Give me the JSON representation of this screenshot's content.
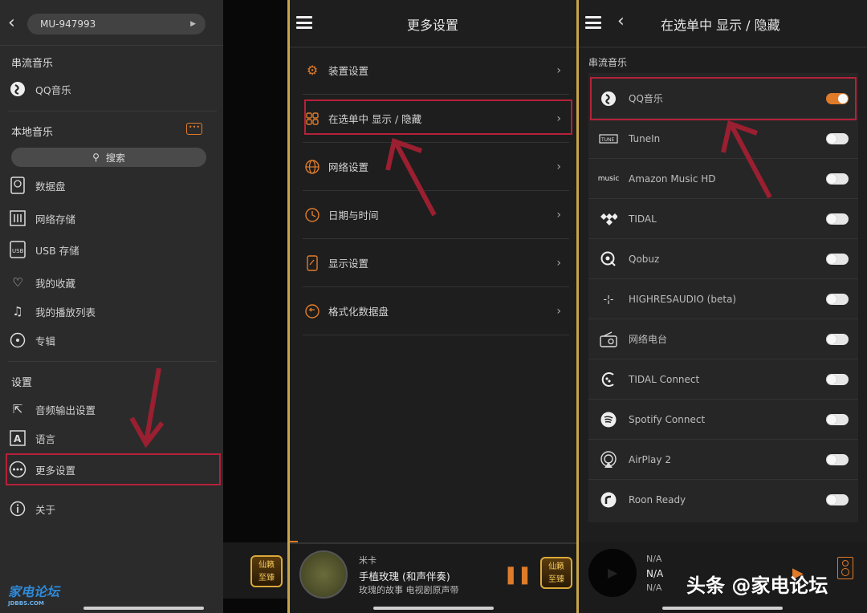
{
  "panel1": {
    "device": "MU-947993",
    "section_streaming": "串流音乐",
    "streaming_items": [
      {
        "label": "QQ音乐",
        "icon": "qq-music-icon"
      }
    ],
    "section_local": "本地音乐",
    "search_label": "搜索",
    "local_items": [
      {
        "label": "数据盘",
        "icon": "disk-icon"
      },
      {
        "label": "网络存储",
        "icon": "nas-icon"
      },
      {
        "label": "USB 存储",
        "icon": "usb-icon"
      },
      {
        "label": "我的收藏",
        "icon": "heart-icon"
      },
      {
        "label": "我的播放列表",
        "icon": "playlist-icon"
      },
      {
        "label": "专辑",
        "icon": "album-icon"
      }
    ],
    "section_settings": "设置",
    "settings_items": [
      {
        "label": "音频输出设置",
        "icon": "audio-output-icon"
      },
      {
        "label": "语言",
        "icon": "language-icon"
      },
      {
        "label": "更多设置",
        "icon": "more-icon"
      },
      {
        "label": "关于",
        "icon": "info-icon"
      }
    ],
    "logo_text": "家电论坛",
    "logo_sub": "JDBBS.COM"
  },
  "panel2": {
    "title": "更多设置",
    "rows": [
      {
        "label": "装置设置",
        "icon": "gear-icon"
      },
      {
        "label": "在选单中 显示 / 隐藏",
        "icon": "grid-icon"
      },
      {
        "label": "网络设置",
        "icon": "globe-icon"
      },
      {
        "label": "日期与时间",
        "icon": "clock-icon"
      },
      {
        "label": "显示设置",
        "icon": "display-icon"
      },
      {
        "label": "格式化数据盘",
        "icon": "format-icon"
      }
    ],
    "player": {
      "artist": "米卡",
      "track": "手植玫瑰 (和声伴奏)",
      "album": "玫瑰的故事 电视剧原声带",
      "badge_line1": "仙籁",
      "badge_line2": "至臻"
    }
  },
  "panel3": {
    "title": "在选单中 显示 / 隐藏",
    "section": "串流音乐",
    "services": [
      {
        "label": "QQ音乐",
        "icon": "qq-music-icon",
        "enabled": true
      },
      {
        "label": "TuneIn",
        "icon": "tunein-icon",
        "enabled": false
      },
      {
        "label": "Amazon Music HD",
        "icon": "amazon-music-icon",
        "enabled": false
      },
      {
        "label": "TIDAL",
        "icon": "tidal-icon",
        "enabled": false
      },
      {
        "label": "Qobuz",
        "icon": "qobuz-icon",
        "enabled": false
      },
      {
        "label": "HIGHRESAUDIO (beta)",
        "icon": "highresaudio-icon",
        "enabled": false
      },
      {
        "label": "网络电台",
        "icon": "radio-icon",
        "enabled": false
      },
      {
        "label": "TIDAL Connect",
        "icon": "tidal-connect-icon",
        "enabled": false
      },
      {
        "label": "Spotify Connect",
        "icon": "spotify-icon",
        "enabled": false
      },
      {
        "label": "AirPlay 2",
        "icon": "airplay-icon",
        "enabled": false
      },
      {
        "label": "Roon Ready",
        "icon": "roon-icon",
        "enabled": false
      }
    ],
    "player": {
      "line1": "N/A",
      "line2": "N/A",
      "line3": "N/A"
    },
    "watermark": "头条 @家电论坛"
  },
  "colors": {
    "accent": "#e07b2a",
    "highlight": "#b5213a",
    "separator": "#c9a54a"
  }
}
